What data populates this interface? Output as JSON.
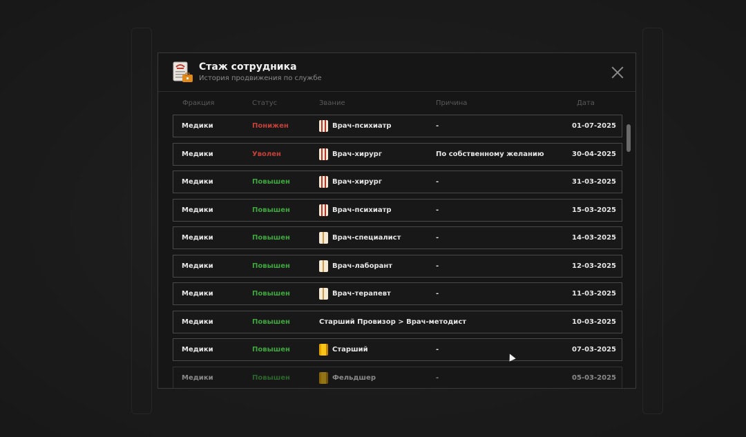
{
  "modal": {
    "title": "Стаж сотрудника",
    "subtitle": "История продвижения по службе",
    "header_icon": "document-briefcase-icon",
    "close_icon": "close-icon"
  },
  "columns": {
    "faction": "Фракция",
    "status": "Статус",
    "rank": "Звание",
    "reason": "Причина",
    "date": "Дата"
  },
  "rows": [
    {
      "faction": "Медики",
      "status": "Понижен",
      "status_color": "#c4413a",
      "rank": "Врач-психиатр",
      "rank_icon": "striped-coat-icon",
      "reason": "-",
      "date": "01-07-2025"
    },
    {
      "faction": "Медики",
      "status": "Уволен",
      "status_color": "#c4413a",
      "rank": "Врач-хирург",
      "rank_icon": "striped-coat-icon",
      "reason": "По собственному желанию",
      "date": "30-04-2025"
    },
    {
      "faction": "Медики",
      "status": "Повышен",
      "status_color": "#3fa63f",
      "rank": "Врач-хирург",
      "rank_icon": "striped-coat-icon",
      "reason": "-",
      "date": "31-03-2025"
    },
    {
      "faction": "Медики",
      "status": "Повышен",
      "status_color": "#3fa63f",
      "rank": "Врач-психиатр",
      "rank_icon": "striped-coat-icon",
      "reason": "-",
      "date": "15-03-2025"
    },
    {
      "faction": "Медики",
      "status": "Повышен",
      "status_color": "#3fa63f",
      "rank": "Врач-специалист",
      "rank_icon": "plain-coat-icon",
      "reason": "-",
      "date": "14-03-2025"
    },
    {
      "faction": "Медики",
      "status": "Повышен",
      "status_color": "#3fa63f",
      "rank": "Врач-лаборант",
      "rank_icon": "plain-coat-icon",
      "reason": "-",
      "date": "12-03-2025"
    },
    {
      "faction": "Медики",
      "status": "Повышен",
      "status_color": "#3fa63f",
      "rank": "Врач-терапевт",
      "rank_icon": "plain-coat-icon",
      "reason": "-",
      "date": "11-03-2025"
    },
    {
      "faction": "Медики",
      "status": "Повышен",
      "status_color": "#3fa63f",
      "rank": "Старший Провизор > Врач-методист",
      "rank_icon": "",
      "reason": "",
      "date": "10-03-2025"
    },
    {
      "faction": "Медики",
      "status": "Повышен",
      "status_color": "#3fa63f",
      "rank": "Старший",
      "rank_icon": "gold-coat-icon",
      "reason": "-",
      "date": "07-03-2025"
    },
    {
      "faction": "Медики",
      "status": "Повышен",
      "status_color": "#3fa63f",
      "rank": "Фельдшер",
      "rank_icon": "gold-coat-icon",
      "reason": "-",
      "date": "05-03-2025"
    }
  ]
}
